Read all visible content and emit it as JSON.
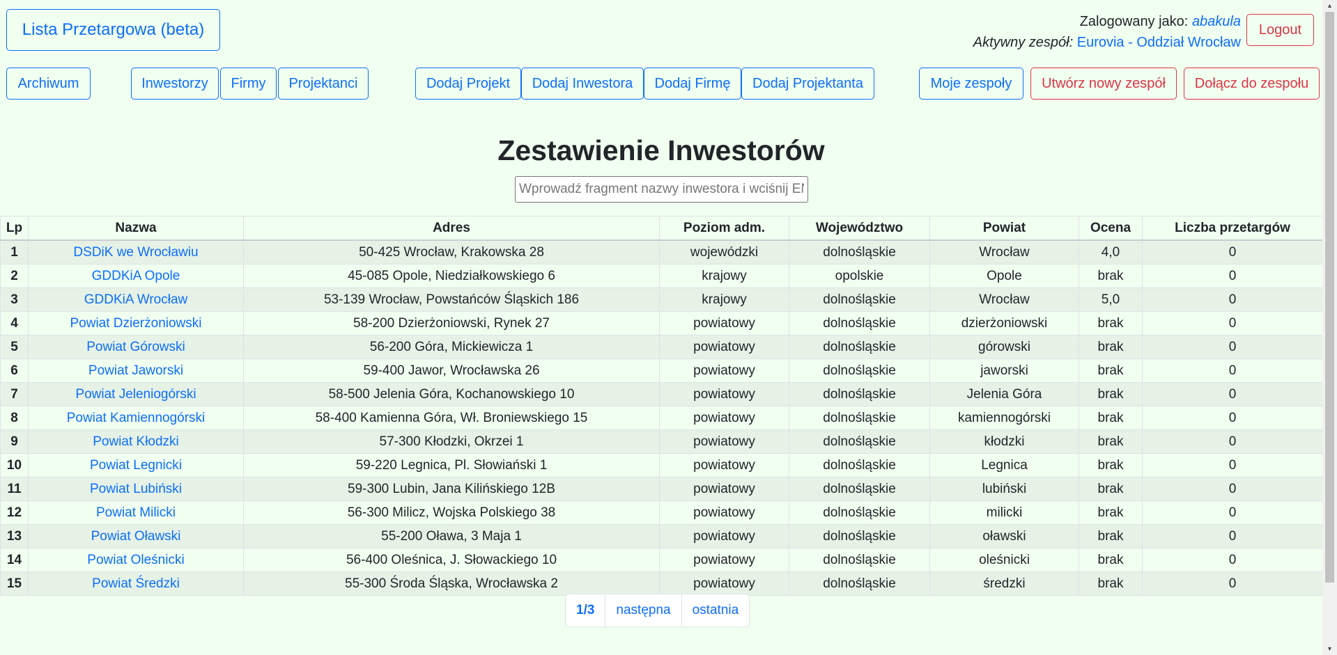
{
  "brand": "Lista Przetargowa (beta)",
  "user": {
    "logged_label": "Zalogowany jako:",
    "username": "abakula",
    "team_label": "Aktywny zespół:",
    "team": "Eurovia - Oddział Wrocław",
    "logout": "Logout"
  },
  "nav": {
    "archiwum": "Archiwum",
    "inwestorzy": "Inwestorzy",
    "firmy": "Firmy",
    "projektanci": "Projektanci",
    "dodaj_projekt": "Dodaj Projekt",
    "dodaj_inwestora": "Dodaj Inwestora",
    "dodaj_firme": "Dodaj Firmę",
    "dodaj_projektanta": "Dodaj Projektanta",
    "moje_zespoly": "Moje zespoły",
    "utworz_zespol": "Utwórz nowy zespół",
    "dolacz": "Dołącz do zespołu"
  },
  "page_title": "Zestawienie Inwestorów",
  "search": {
    "placeholder": "Wprowadź fragment nazwy inwestora i wciśnij ENTER"
  },
  "table": {
    "headers": [
      "Lp",
      "Nazwa",
      "Adres",
      "Poziom adm.",
      "Województwo",
      "Powiat",
      "Ocena",
      "Liczba przetargów"
    ],
    "rows": [
      [
        "1",
        "DSDiK we Wrocławiu",
        "50-425 Wrocław, Krakowska 28",
        "wojewódzki",
        "dolnośląskie",
        "Wrocław",
        "4,0",
        "0"
      ],
      [
        "2",
        "GDDKiA Opole",
        "45-085 Opole, Niedziałkowskiego 6",
        "krajowy",
        "opolskie",
        "Opole",
        "brak",
        "0"
      ],
      [
        "3",
        "GDDKiA Wrocław",
        "53-139 Wrocław, Powstańców Śląskich 186",
        "krajowy",
        "dolnośląskie",
        "Wrocław",
        "5,0",
        "0"
      ],
      [
        "4",
        "Powiat Dzierżoniowski",
        "58-200 Dzierżoniowski, Rynek 27",
        "powiatowy",
        "dolnośląskie",
        "dzierżoniowski",
        "brak",
        "0"
      ],
      [
        "5",
        "Powiat Górowski",
        "56-200 Góra, Mickiewicza 1",
        "powiatowy",
        "dolnośląskie",
        "górowski",
        "brak",
        "0"
      ],
      [
        "6",
        "Powiat Jaworski",
        "59-400 Jawor, Wrocławska 26",
        "powiatowy",
        "dolnośląskie",
        "jaworski",
        "brak",
        "0"
      ],
      [
        "7",
        "Powiat Jeleniogórski",
        "58-500 Jelenia Góra, Kochanowskiego 10",
        "powiatowy",
        "dolnośląskie",
        "Jelenia Góra",
        "brak",
        "0"
      ],
      [
        "8",
        "Powiat Kamiennogórski",
        "58-400 Kamienna Góra, Wł. Broniewskiego 15",
        "powiatowy",
        "dolnośląskie",
        "kamiennogórski",
        "brak",
        "0"
      ],
      [
        "9",
        "Powiat Kłodzki",
        "57-300 Kłodzki, Okrzei 1",
        "powiatowy",
        "dolnośląskie",
        "kłodzki",
        "brak",
        "0"
      ],
      [
        "10",
        "Powiat Legnicki",
        "59-220 Legnica, Pl. Słowiański 1",
        "powiatowy",
        "dolnośląskie",
        "Legnica",
        "brak",
        "0"
      ],
      [
        "11",
        "Powiat Lubiński",
        "59-300 Lubin, Jana Kilińskiego 12B",
        "powiatowy",
        "dolnośląskie",
        "lubiński",
        "brak",
        "0"
      ],
      [
        "12",
        "Powiat Milicki",
        "56-300 Milicz, Wojska Polskiego 38",
        "powiatowy",
        "dolnośląskie",
        "milicki",
        "brak",
        "0"
      ],
      [
        "13",
        "Powiat Oławski",
        "55-200 Oława, 3 Maja 1",
        "powiatowy",
        "dolnośląskie",
        "oławski",
        "brak",
        "0"
      ],
      [
        "14",
        "Powiat Oleśnicki",
        "56-400 Oleśnica, J. Słowackiego 10",
        "powiatowy",
        "dolnośląskie",
        "oleśnicki",
        "brak",
        "0"
      ],
      [
        "15",
        "Powiat Średzki",
        "55-300 Środa Śląska, Wrocławska 2",
        "powiatowy",
        "dolnośląskie",
        "średzki",
        "brak",
        "0"
      ]
    ]
  },
  "pagination": {
    "current": "1/3",
    "next": "następna",
    "last": "ostatnia"
  },
  "colors": {
    "accent": "#0d6efd",
    "danger": "#dc3545",
    "background": "#f0fff0"
  }
}
